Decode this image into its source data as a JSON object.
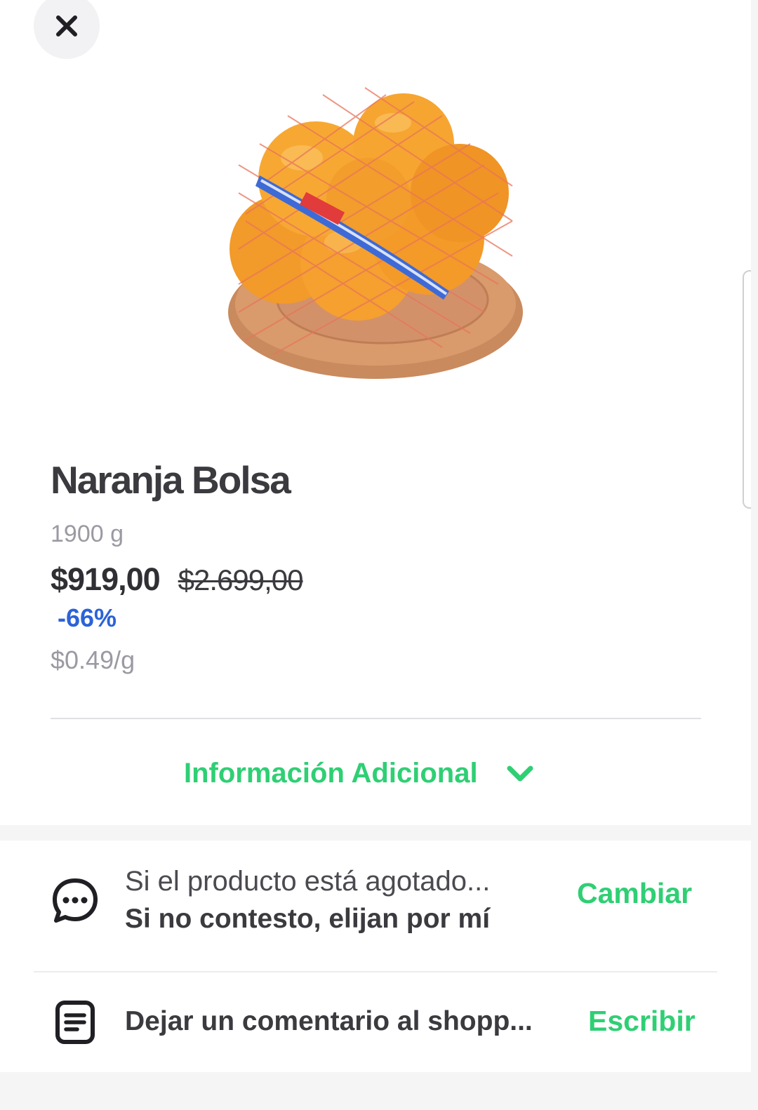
{
  "header": {
    "close_icon": "close-icon"
  },
  "product": {
    "name": "Naranja Bolsa",
    "weight": "1900 g",
    "price": "$919,00",
    "original_price": "$2.699,00",
    "discount": "-66%",
    "unit_price": "$0.49/g",
    "image_icon": "orange-bag-image"
  },
  "info": {
    "label": "Información Adicional",
    "icon": "chevron-down-icon"
  },
  "out_of_stock": {
    "icon": "chat-bubble-icon",
    "title": "Si el producto está agotado...",
    "value": "Si no contesto, elijan por mí",
    "action": "Cambiar"
  },
  "comment": {
    "icon": "note-icon",
    "label": "Dejar un comentario al shopp...",
    "action": "Escribir"
  },
  "colors": {
    "accent_green": "#2fcf74",
    "discount_blue": "#2b63d8",
    "text_dark": "#3a3a3f",
    "text_muted": "#9a9aa3"
  }
}
